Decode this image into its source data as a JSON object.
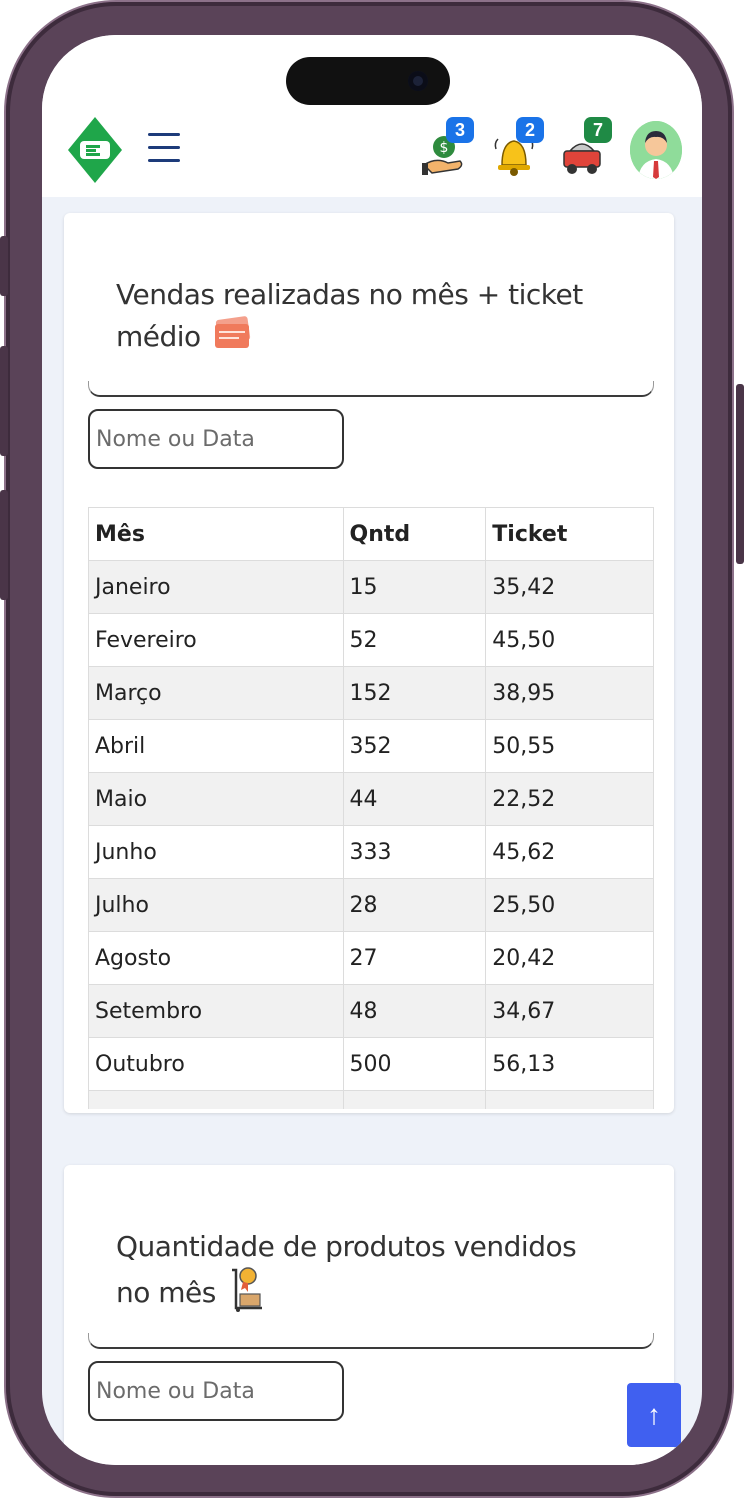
{
  "header": {
    "badges": {
      "money": "3",
      "bell": "2",
      "delivery": "7"
    },
    "icons": {
      "logo": "logo-icon",
      "menu": "hamburger-menu-icon",
      "money": "money-hand-icon",
      "bell": "bell-icon",
      "delivery": "delivery-cart-icon",
      "avatar": "user-avatar-icon"
    },
    "colors": {
      "logo_green": "#1fa64a",
      "menu_blue": "#1d3b7a",
      "badge_blue": "#1a73e8",
      "badge_green": "#1f8a45"
    }
  },
  "sales_card": {
    "title": "Vendas realizadas no mês + ticket médio",
    "title_icon": "ticket-icon",
    "search_placeholder": "Nome ou Data",
    "columns": [
      "Mês",
      "Qntd",
      "Ticket"
    ],
    "rows": [
      [
        "Janeiro",
        "15",
        "35,42"
      ],
      [
        "Fevereiro",
        "52",
        "45,50"
      ],
      [
        "Março",
        "152",
        "38,95"
      ],
      [
        "Abril",
        "352",
        "50,55"
      ],
      [
        "Maio",
        "44",
        "22,52"
      ],
      [
        "Junho",
        "333",
        "45,62"
      ],
      [
        "Julho",
        "28",
        "25,50"
      ],
      [
        "Agosto",
        "27",
        "20,42"
      ],
      [
        "Setembro",
        "48",
        "34,67"
      ],
      [
        "Outubro",
        "500",
        "56,13"
      ]
    ]
  },
  "products_card": {
    "title": "Quantidade de produtos vendidos no mês",
    "title_icon": "award-dolly-icon",
    "search_placeholder": "Nome ou Data"
  },
  "scroll_top": {
    "glyph": "↑",
    "color": "#4060f0"
  }
}
